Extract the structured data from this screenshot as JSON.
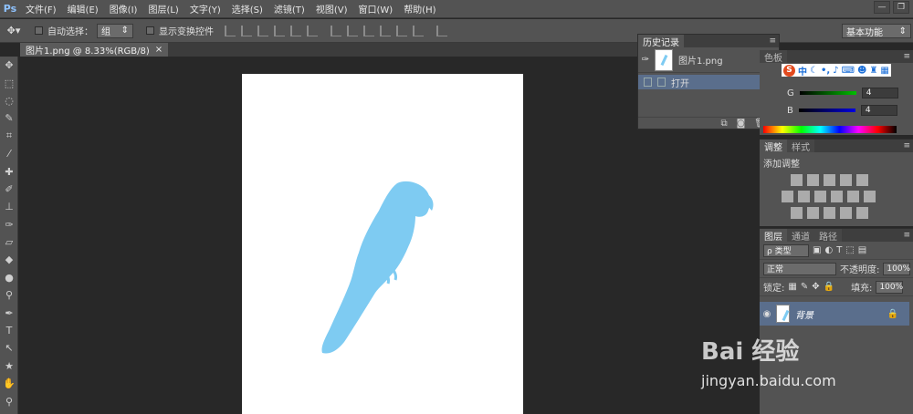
{
  "app": {
    "logo": "Ps"
  },
  "menu": [
    "文件(F)",
    "编辑(E)",
    "图像(I)",
    "图层(L)",
    "文字(Y)",
    "选择(S)",
    "滤镜(T)",
    "视图(V)",
    "窗口(W)",
    "帮助(H)"
  ],
  "window_buttons": [
    "—",
    "❐"
  ],
  "options": {
    "auto_select_label": "自动选择：",
    "auto_select_value": "组",
    "show_transform_label": "显示变换控件",
    "workspace": "基本功能"
  },
  "doc_tab": {
    "title": "图片1.png @ 8.33%(RGB/8)",
    "close": "×"
  },
  "history": {
    "tab": "历史记录",
    "snapshot_name": "图片1.png",
    "step": "打开"
  },
  "color": {
    "tab": "色板",
    "ime_s": "S",
    "ime_zh": "中",
    "g_label": "G",
    "g_value": "4",
    "b_label": "B",
    "b_value": "4"
  },
  "adjustments": {
    "tab": "调整",
    "tab2": "样式",
    "title": "添加调整"
  },
  "layers": {
    "tab1": "图层",
    "tab2": "通道",
    "tab3": "路径",
    "kind": "ρ 类型",
    "blend": "正常",
    "opacity_label": "不透明度:",
    "opacity_value": "100%",
    "lock_label": "锁定:",
    "fill_label": "填充:",
    "fill_value": "100%",
    "layer_name": "背景"
  },
  "watermark": {
    "logo": "Bai 经验",
    "url": "jingyan.baidu.com"
  },
  "colors": {
    "accent": "#5a6e8c",
    "parrot": "#7ecbf2",
    "panel": "#535353"
  }
}
